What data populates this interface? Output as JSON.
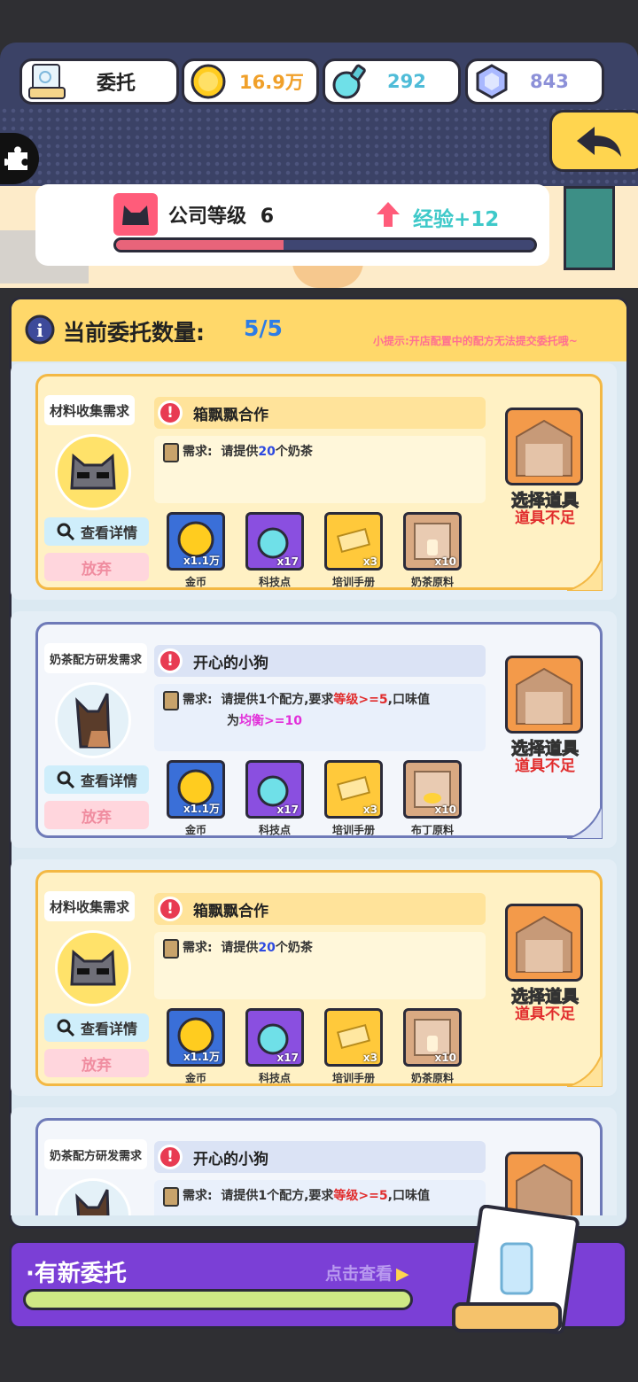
{
  "hud": {
    "title": "委托",
    "coins": "16.9万",
    "tech_points": "292",
    "gems": "843",
    "icons": {
      "doc": "document-icon",
      "coin": "coin-icon",
      "tech": "flask-icon",
      "gem": "gem-icon",
      "back": "back-arrow-icon",
      "puzzle": "puzzle-icon"
    }
  },
  "company": {
    "level_label": "公司等级",
    "level": "6",
    "exp": "经验+12",
    "progress": 0.4
  },
  "panel": {
    "count_label": "当前委托数量:",
    "count": "5/5",
    "tip": "小提示:开店配置中的配方无法提交委托哦~"
  },
  "common": {
    "detail": "查看详情",
    "quit": "放弃",
    "pick": "选择道具",
    "lack": "道具不足",
    "req_prefix": "需求:"
  },
  "cards": [
    {
      "kind": "材料收集需求",
      "title": "箱飘飘合作",
      "theme": "yellow",
      "req1": "请提供",
      "req_num": "20",
      "req2": "个奶茶",
      "req_line2": "",
      "rewards": [
        {
          "label": "金币",
          "count": "x1.1万"
        },
        {
          "label": "科技点",
          "count": "x17"
        },
        {
          "label": "培训手册",
          "count": "x3"
        },
        {
          "label": "奶茶原料",
          "count": "x10"
        }
      ]
    },
    {
      "kind": "奶茶配方研发需求",
      "title": "开心的小狗",
      "theme": "blue",
      "req1": "请提供1个配方,要求",
      "req_a": "等级",
      "req_b": ">=5",
      "req_c": ",口味值",
      "req_line2a": "为",
      "req_line2b": "均衡",
      "req_line2c": ">=10",
      "rewards": [
        {
          "label": "金币",
          "count": "x1.1万"
        },
        {
          "label": "科技点",
          "count": "x17"
        },
        {
          "label": "培训手册",
          "count": "x3"
        },
        {
          "label": "布丁原料",
          "count": "x10"
        }
      ]
    },
    {
      "kind": "材料收集需求",
      "title": "箱飘飘合作",
      "theme": "yellow",
      "req1": "请提供",
      "req_num": "20",
      "req2": "个奶茶",
      "rewards": [
        {
          "label": "金币",
          "count": "x1.1万"
        },
        {
          "label": "科技点",
          "count": "x17"
        },
        {
          "label": "培训手册",
          "count": "x3"
        },
        {
          "label": "奶茶原料",
          "count": "x10"
        }
      ]
    },
    {
      "kind": "奶茶配方研发需求",
      "title": "开心的小狗",
      "theme": "blue",
      "req1": "请提供1个配方,要求",
      "req_a": "等级",
      "req_b": ">=5",
      "req_c": ",口味值"
    }
  ],
  "new_bar": {
    "label": "·有新委托",
    "action": "点击查看"
  }
}
